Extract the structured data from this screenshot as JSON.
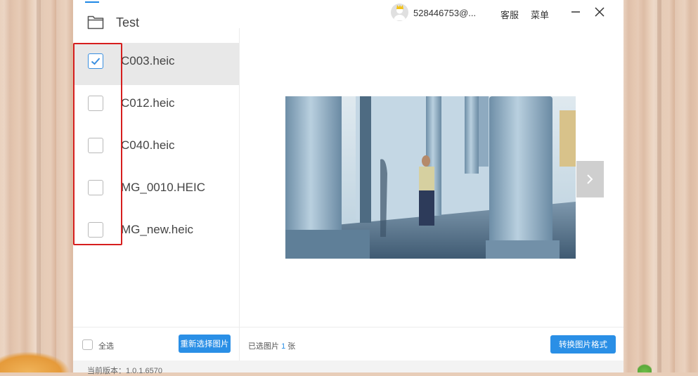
{
  "window": {
    "folder_name": "Test",
    "account": "528446753@...",
    "service_label": "客服",
    "menu_label": "菜单"
  },
  "files": [
    {
      "name": "C003.heic",
      "checked": true
    },
    {
      "name": "C012.heic",
      "checked": false
    },
    {
      "name": "C040.heic",
      "checked": false
    },
    {
      "name": "MG_0010.HEIC",
      "checked": false
    },
    {
      "name": "MG_new.heic",
      "checked": false
    }
  ],
  "bottom": {
    "select_all": "全选",
    "reselect_button": "重新选择图片",
    "selected_prefix": "已选图片",
    "selected_count": "1",
    "selected_suffix": "张",
    "convert_button": "转换图片格式"
  },
  "footer": {
    "version": "当前版本：1.0.1.6570"
  },
  "colors": {
    "accent": "#2a8fe6",
    "highlight": "#d61e1e"
  }
}
